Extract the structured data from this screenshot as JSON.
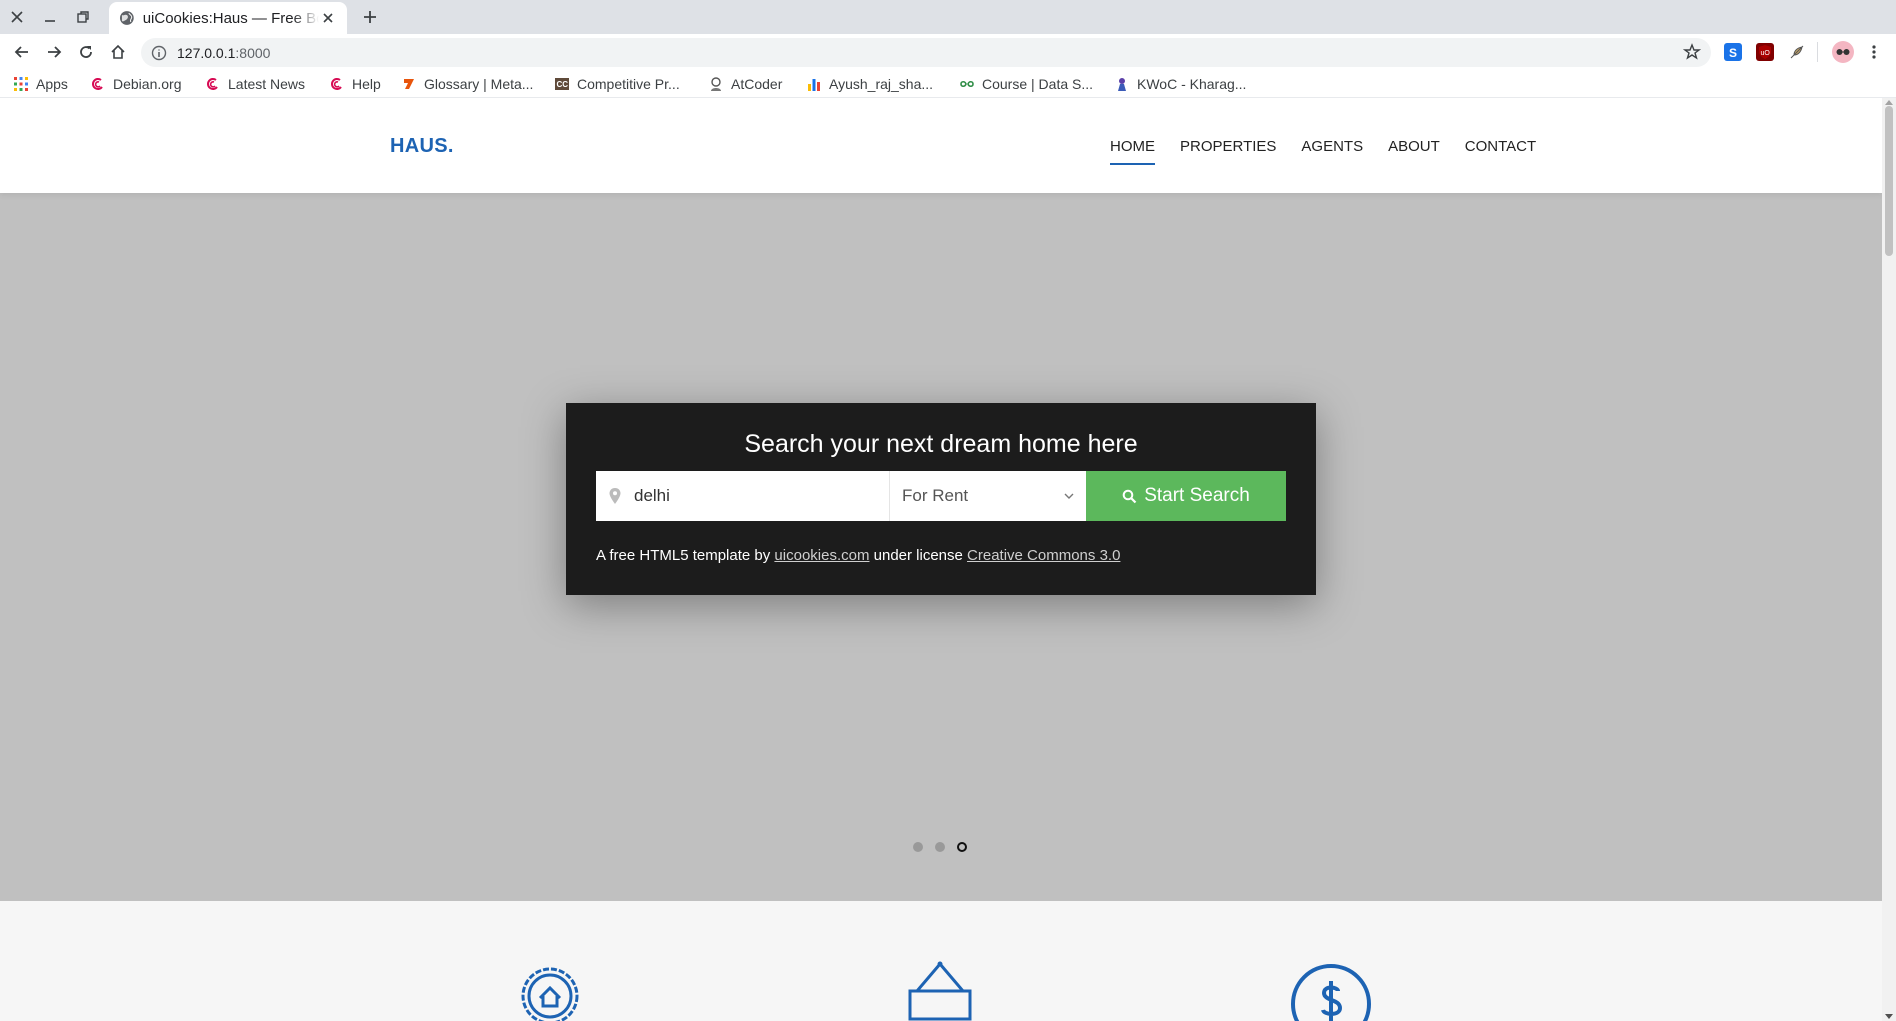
{
  "browser": {
    "tab_title": "uiCookies:Haus — Free Bootstrap",
    "url_host": "127.0.0.1",
    "url_port": ":8000",
    "bookmarks": [
      {
        "label": "Apps",
        "icon": "apps-grid-icon",
        "color": "#4285f4"
      },
      {
        "label": "Debian.org",
        "icon": "debian-icon",
        "color": "#d70a53"
      },
      {
        "label": "Latest News",
        "icon": "debian-icon",
        "color": "#d70a53"
      },
      {
        "label": "Help",
        "icon": "debian-icon",
        "color": "#d70a53"
      },
      {
        "label": "Glossary | Meta...",
        "icon": "glossary-icon",
        "color": "#e8550c"
      },
      {
        "label": "Competitive Pr...",
        "icon": "cc-icon",
        "color": "#5f4a3a"
      },
      {
        "label": "AtCoder",
        "icon": "atcoder-icon",
        "color": "#555555"
      },
      {
        "label": "Ayush_raj_sha...",
        "icon": "bar-chart-icon",
        "color": "#1a73e8"
      },
      {
        "label": "Course | Data S...",
        "icon": "gfg-icon",
        "color": "#2f8d46"
      },
      {
        "label": "KWoC - Kharag...",
        "icon": "kwoc-icon",
        "color": "#5b3fa8"
      }
    ]
  },
  "site": {
    "logo": "HAUS.",
    "brand_color": "#1d63b3",
    "menu": [
      {
        "label": "HOME",
        "active": true
      },
      {
        "label": "PROPERTIES",
        "active": false
      },
      {
        "label": "AGENTS",
        "active": false
      },
      {
        "label": "ABOUT",
        "active": false
      },
      {
        "label": "CONTACT",
        "active": false
      }
    ]
  },
  "hero": {
    "heading": "Search your next dream home here",
    "location_value": "delhi",
    "listing_type": "For Rent",
    "search_button": "Start Search",
    "button_color": "#5cb85c",
    "credit_prefix": "A free HTML5 template by ",
    "credit_link1": "uicookies.com",
    "credit_middle": " under license ",
    "credit_link2": "Creative Commons 3.0",
    "slides_total": 3,
    "active_slide": 3
  },
  "features": {
    "icons": [
      "badge-home-icon",
      "new-sign-icon",
      "dollar-circle-icon"
    ]
  }
}
